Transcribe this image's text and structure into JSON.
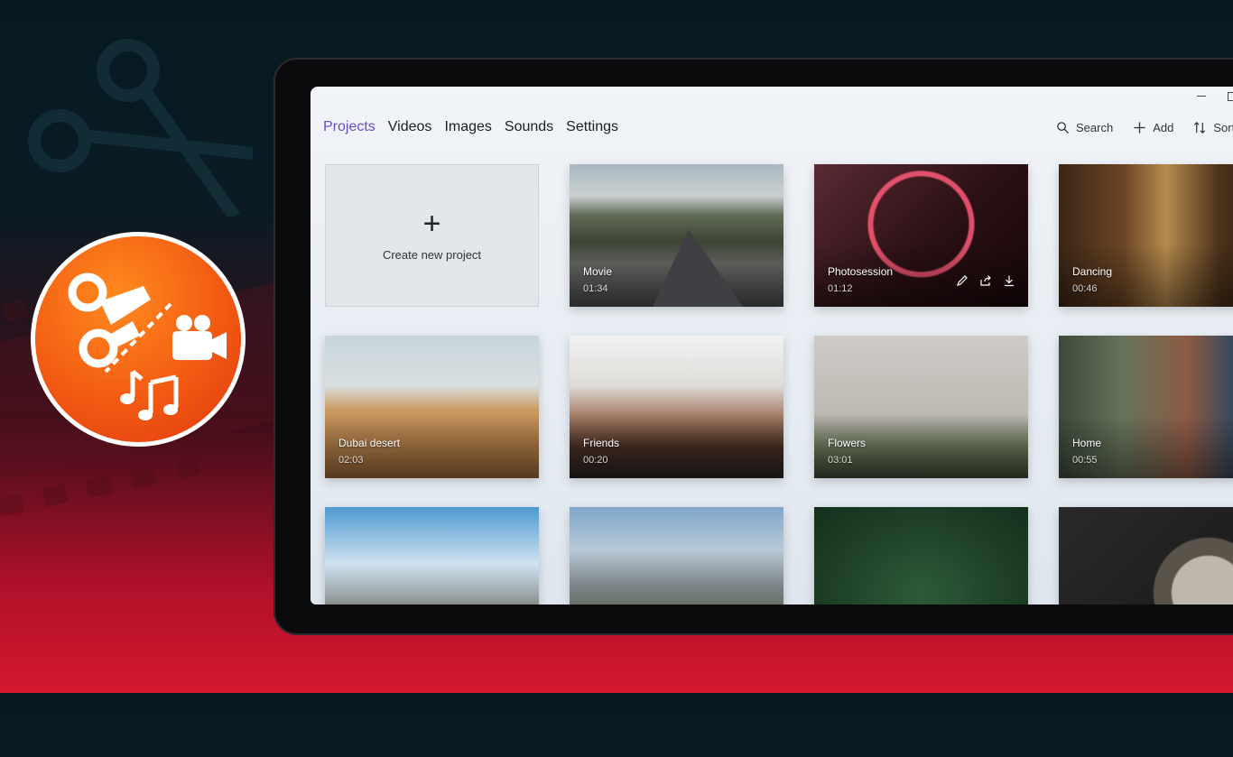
{
  "nav": {
    "tabs": [
      {
        "label": "Projects",
        "active": true
      },
      {
        "label": "Videos",
        "active": false
      },
      {
        "label": "Images",
        "active": false
      },
      {
        "label": "Sounds",
        "active": false
      },
      {
        "label": "Settings",
        "active": false
      }
    ]
  },
  "actions": {
    "search_label": "Search",
    "add_label": "Add",
    "sort_label": "Sort"
  },
  "new_project": {
    "plus": "+",
    "label": "Create new project"
  },
  "projects": [
    {
      "title": "Movie",
      "duration": "01:34"
    },
    {
      "title": "Photosession",
      "duration": "01:12"
    },
    {
      "title": "Dancing",
      "duration": "00:46"
    },
    {
      "title": "Dubai desert",
      "duration": "02:03"
    },
    {
      "title": "Friends",
      "duration": "00:20"
    },
    {
      "title": "Flowers",
      "duration": "03:01"
    },
    {
      "title": "Home",
      "duration": "00:55"
    }
  ],
  "colors": {
    "accent": "#6a4fc9",
    "logo_orange": "#f25a12",
    "background_red": "#d4182e"
  }
}
